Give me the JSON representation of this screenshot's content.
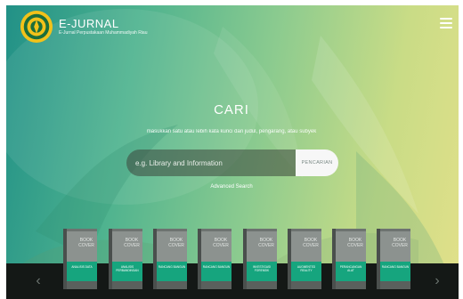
{
  "header": {
    "title": "E-JURNAL",
    "subtitle": "E-Jurnal Perpustakaan Muhammadiyah Riau"
  },
  "hero": {
    "title": "CARI",
    "subtitle": "masukkan satu atau lebih kata kunci dari judul, pengarang, atau subyek"
  },
  "search": {
    "placeholder": "e.g. Library and Information",
    "button_label": "PENCARIAN",
    "advanced_label": "Advanced Search"
  },
  "shelf": {
    "prev_label": "‹",
    "next_label": "›",
    "cover_text": "BOOK\nCOVER",
    "books": [
      {
        "title": "ANALISIS DATA"
      },
      {
        "title": "ANALISIS PERBANDINGAN"
      },
      {
        "title": "RANCANG BANGUN"
      },
      {
        "title": "RANCANG BANGUN"
      },
      {
        "title": "INVESTIGASI FORENSIK"
      },
      {
        "title": "AUGMENTED REALITY"
      },
      {
        "title": "PERANCANGAN ALAT"
      },
      {
        "title": "RANCANG BANGUN"
      }
    ]
  },
  "colors": {
    "accent": "#16a57e",
    "shelf": "#141816"
  }
}
